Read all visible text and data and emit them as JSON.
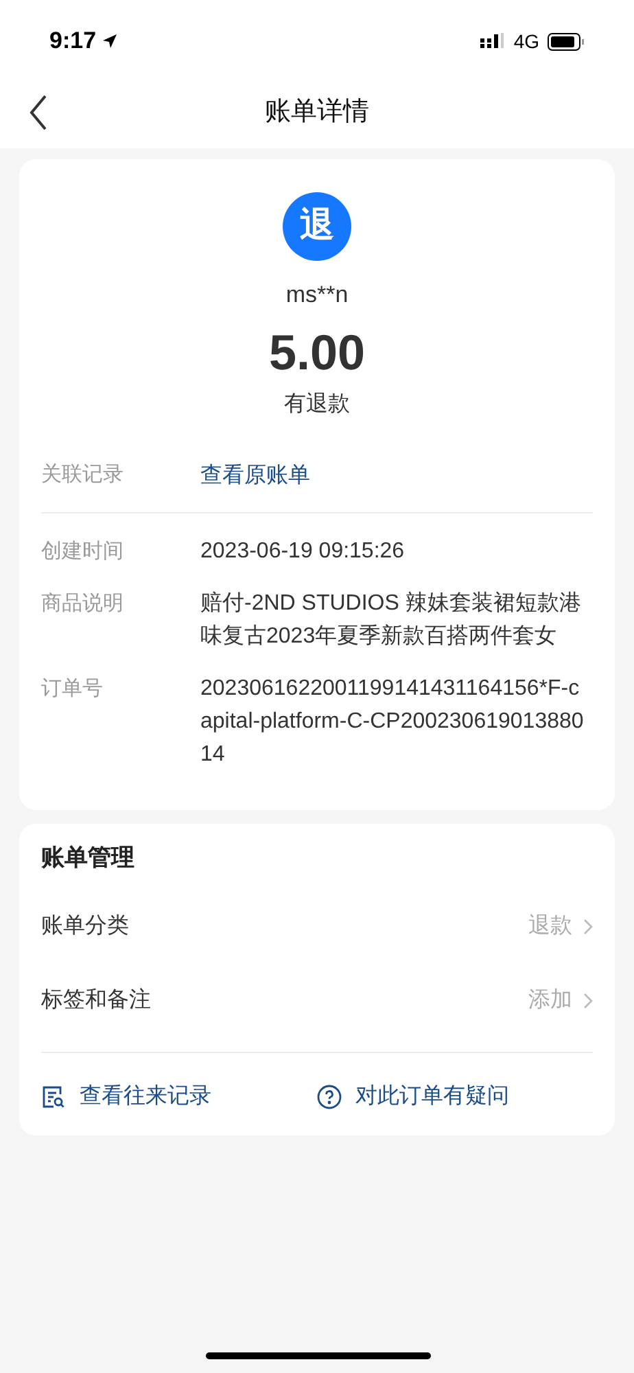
{
  "status_bar": {
    "time": "9:17",
    "network": "4G"
  },
  "nav": {
    "title": "账单详情"
  },
  "summary": {
    "badge": "退",
    "name": "ms**n",
    "amount": "5.00",
    "status": "有退款"
  },
  "related": {
    "label": "关联记录",
    "link": "查看原账单"
  },
  "details": [
    {
      "label": "创建时间",
      "value": "2023-06-19 09:15:26"
    },
    {
      "label": "商品说明",
      "value": "赔付-2ND STUDIOS 辣妹套装裙短款港味复古2023年夏季新款百搭两件套女"
    },
    {
      "label": "订单号",
      "value": "2023061622001199141431164156*F-capital-platform-C-CP20023061901388014"
    }
  ],
  "management": {
    "title": "账单管理",
    "rows": [
      {
        "label": "账单分类",
        "value": "退款"
      },
      {
        "label": "标签和备注",
        "value": "添加"
      }
    ],
    "actions": [
      {
        "kind": "records",
        "label": "查看往来记录"
      },
      {
        "kind": "question",
        "label": "对此订单有疑问"
      }
    ]
  }
}
